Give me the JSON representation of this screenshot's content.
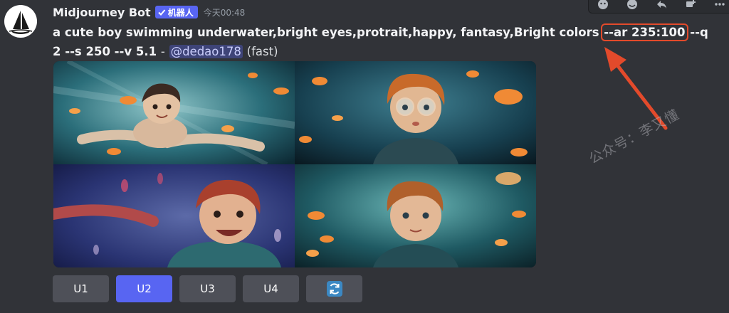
{
  "message": {
    "author": "Midjourney Bot",
    "bot_tag": "机器人",
    "timestamp": "今天00:48",
    "prompt": {
      "main": "a cute boy swimming underwater,bright eyes,protrait,happy, fantasy,Bright colors",
      "highlighted": "--ar 235:100",
      "params": "--q 2 --s 250 --v 5.1",
      "separator": "-",
      "mention": "@dedao178",
      "speed": "(fast)"
    }
  },
  "image": {
    "cells": [
      {
        "name": "boy-swimming-arms-out"
      },
      {
        "name": "boy-with-goggles-orange-hair"
      },
      {
        "name": "boy-smiling-red-hair"
      },
      {
        "name": "boy-with-fish"
      }
    ]
  },
  "buttons": [
    {
      "label": "U1",
      "active": false
    },
    {
      "label": "U2",
      "active": true
    },
    {
      "label": "U3",
      "active": false
    },
    {
      "label": "U4",
      "active": false
    }
  ],
  "reroll_icon": "refresh-icon",
  "toolbar_icons": [
    "add-reaction-icon",
    "emoji-icon",
    "reply-icon",
    "create-thread-icon",
    "more-icon"
  ],
  "watermark": "公众号：李又懂",
  "colors": {
    "accent": "#5865f2",
    "highlight_box": "#e34a2b",
    "background": "#313338"
  }
}
